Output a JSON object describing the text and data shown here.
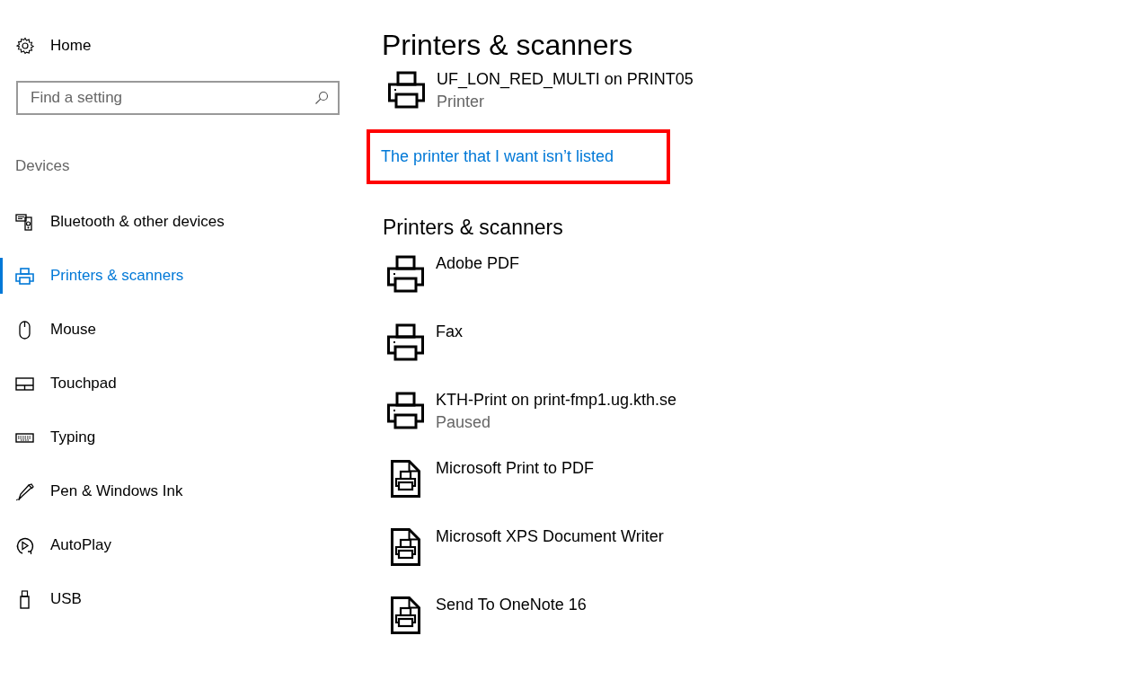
{
  "sidebar": {
    "home": "Home",
    "search": {
      "placeholder": "Find a setting"
    },
    "section": "Devices",
    "items": [
      {
        "label": "Bluetooth & other devices",
        "selected": false
      },
      {
        "label": "Printers & scanners",
        "selected": true
      },
      {
        "label": "Mouse",
        "selected": false
      },
      {
        "label": "Touchpad",
        "selected": false
      },
      {
        "label": "Typing",
        "selected": false
      },
      {
        "label": "Pen & Windows Ink",
        "selected": false
      },
      {
        "label": "AutoPlay",
        "selected": false
      },
      {
        "label": "USB",
        "selected": false
      }
    ]
  },
  "main": {
    "title": "Printers & scanners",
    "top_device": {
      "name": "UF_LON_RED_MULTI on PRINT05",
      "status": "Printer",
      "kind": "printer"
    },
    "link": {
      "text": "The printer that I want isn’t listed",
      "highlighted": true
    },
    "section": "Printers & scanners",
    "devices": [
      {
        "name": "Adobe PDF",
        "kind": "printer"
      },
      {
        "name": "Fax",
        "kind": "printer"
      },
      {
        "name": "KTH-Print on print-fmp1.ug.kth.se",
        "status": "Paused",
        "kind": "printer"
      },
      {
        "name": "Microsoft Print to PDF",
        "kind": "document"
      },
      {
        "name": "Microsoft XPS Document Writer",
        "kind": "document"
      },
      {
        "name": "Send To OneNote 16",
        "kind": "document"
      }
    ]
  }
}
